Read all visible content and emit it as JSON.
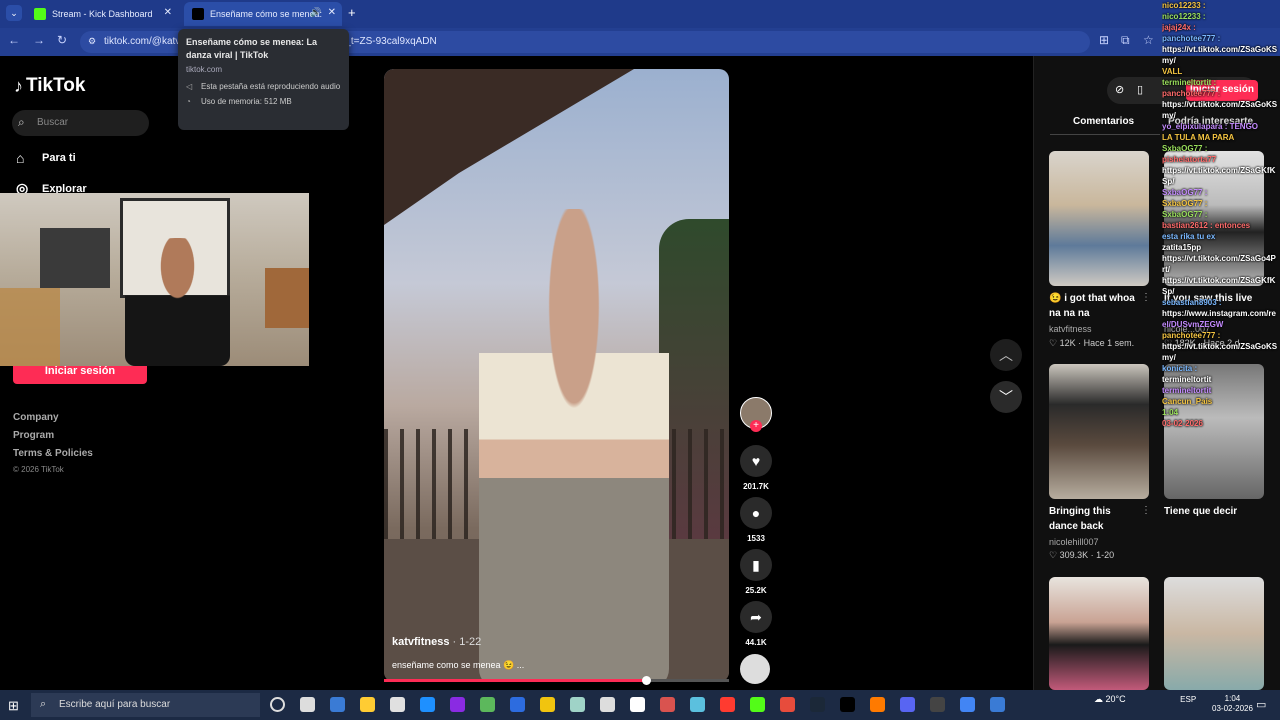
{
  "browser": {
    "tabs": [
      {
        "title": "Stream - Kick Dashboard"
      },
      {
        "title": "Enseñame cómo se menea: "
      }
    ],
    "new_tab": "+",
    "url": "tiktok.com/@katv                                                         &_t=ZS-93cal9xqADN"
  },
  "tooltip": {
    "title": "Enseñame cómo se menea: La danza viral | TikTok",
    "domain": "tiktok.com",
    "audio": "Esta pestaña está reproduciendo audio",
    "memory": "Uso de memoria: 512 MB"
  },
  "sidebar": {
    "logo": "TikTok",
    "search_placeholder": "Buscar",
    "nav": [
      "Para ti",
      "Explorar"
    ],
    "login": "Iniciar sesión",
    "footer": [
      "Company",
      "Program",
      "Terms & Policies"
    ],
    "copyright": "© 2026 TikTok"
  },
  "video": {
    "user": "katvfitness",
    "date": "· 1-22",
    "caption": "enseñame como se menea 😉 ...",
    "progress": 0.76,
    "likes": "201.7K",
    "comments": "1533",
    "saves": "25.2K",
    "shares": "44.1K"
  },
  "header": {
    "login": "Iniciar sesión"
  },
  "panel": {
    "tabs": [
      "Comentarios",
      "Podría interesarte"
    ],
    "items": [
      {
        "title": "😉 i got that whoa na na na",
        "author": "katvfitness",
        "stats": "♡ 12K · Hace 1 sem."
      },
      {
        "title": "If you saw this live",
        "author": "nicole...007",
        "stats": "♡ 182K · Hace 2 d"
      },
      {
        "title": "Bringing this dance back",
        "author": "nicolehill007",
        "stats": "♡ 309.3K · 1-20"
      },
      {
        "title": "Tiene que decir",
        "author": "",
        "stats": ""
      }
    ]
  },
  "chat": [
    "nico12233 :",
    "nico12233 :",
    "jajaj24x :",
    "panchotee777 :",
    "https://vt.tiktok.com/ZSaGoKS",
    "my/",
    "VALL",
    "termineltortit :",
    "panchotee777 :",
    "https://vt.tiktok.com/ZSaGoKS",
    "my/",
    "yo_elpixulapara : TENGO",
    "LA TULA MA PARA",
    "SxbaOG77 :",
    "pishelatorta77",
    "https://vt.tiktok.com/ZSaGKfK",
    "Sp/",
    "SxbaOG77 :",
    "SxbaOG77 :",
    "SxbaOG77 :",
    "bastian2612 : entonces",
    "esta rika tu ex",
    "zatita15pp",
    "https://vt.tiktok.com/ZSaGo4P",
    "rt/",
    "https://vt.tiktok.com/ZSaGKfK",
    "Sp/",
    "sebastian8903 :",
    "https://www.instagram.com/re",
    "el/DUSvmZEGW",
    "panchotee777 :",
    "https://vt.tiktok.com/ZSaGoKS",
    "my/",
    "konicita :",
    "termineltortit",
    "termineltortit",
    "Cancun_Pais",
    "1:04",
    "03-02-2026"
  ],
  "taskbar": {
    "search": "Escribe aquí para buscar",
    "weather": "20°C",
    "lang": "ESP",
    "time": "1:04",
    "date": "03-02-2026"
  },
  "colors": {
    "accent": "#fe2c55",
    "chrome": "#1f3a8a",
    "taskbar": "#1c2a44"
  }
}
